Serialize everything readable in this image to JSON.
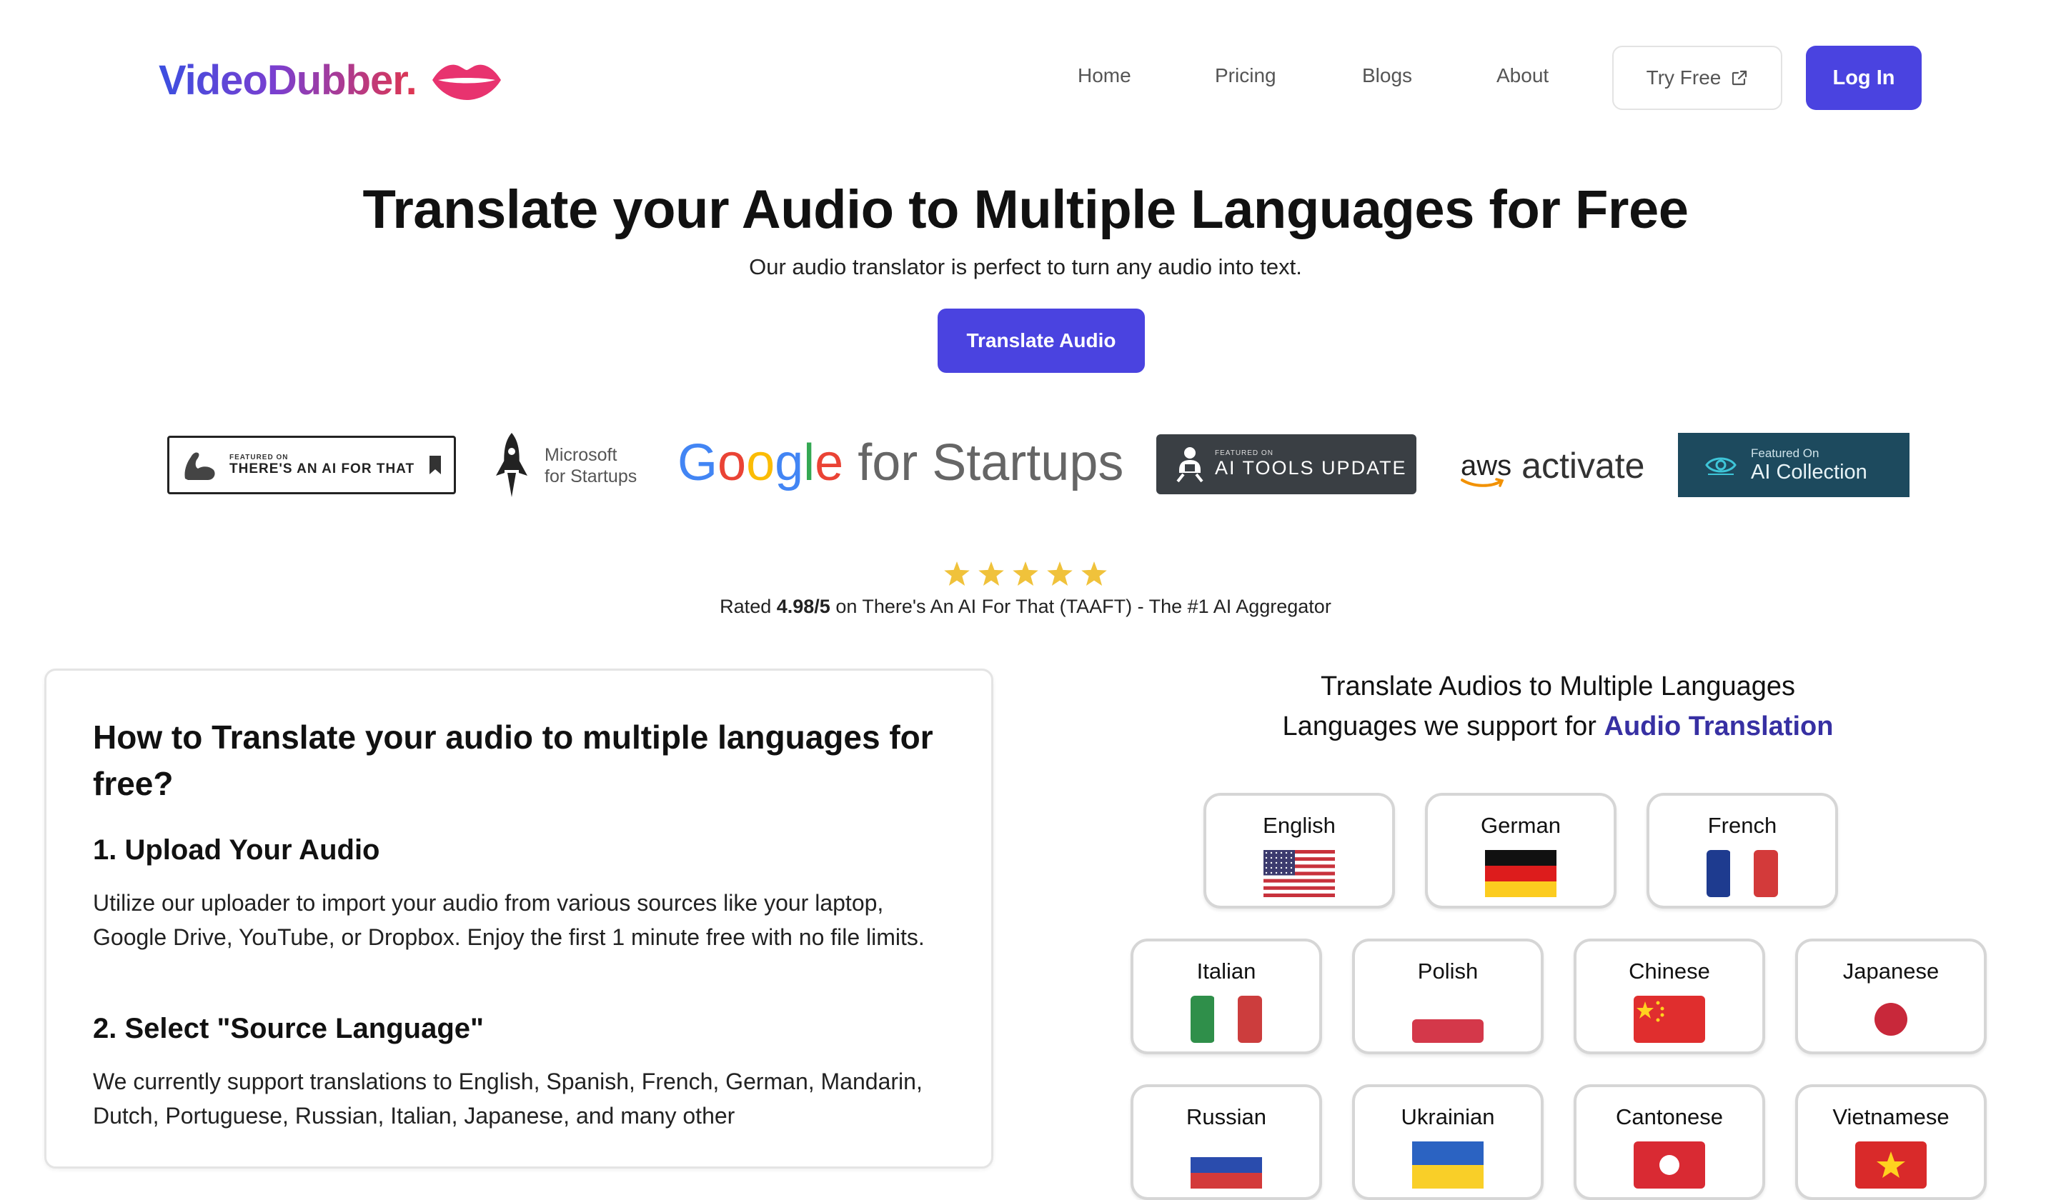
{
  "header": {
    "logo_text": "VideoDubber.",
    "nav": [
      "Home",
      "Pricing",
      "Blogs",
      "About"
    ],
    "try_free": "Try Free",
    "login": "Log In"
  },
  "hero": {
    "title": "Translate your Audio to Multiple Languages for Free",
    "subtitle": "Our audio translator is perfect to turn any audio into text.",
    "cta": "Translate Audio"
  },
  "featured": {
    "taaft_small": "FEATURED ON",
    "taaft_big": "THERE'S AN AI FOR THAT",
    "ms_line1": "Microsoft",
    "ms_line2": "for Startups",
    "google": "Google",
    "google_startups": "for Startups",
    "aitools_small": "FEATURED ON",
    "aitools_big": "AI TOOLS UPDATE",
    "aws": "aws",
    "aws_activate": "activate",
    "aicoll_small": "Featured On",
    "aicoll_big": "AI Collection"
  },
  "rating": {
    "stars": 5,
    "prefix": "Rated ",
    "score": "4.98/5",
    "suffix": " on There's An AI For That (TAAFT) - The #1 AI Aggregator"
  },
  "howto": {
    "title": "How to Translate your audio to multiple languages for free?",
    "steps": [
      {
        "title": "1. Upload Your Audio",
        "body": "Utilize our uploader to import your audio from various sources like your laptop, Google Drive, YouTube, or Dropbox. Enjoy the first 1 minute free with no file limits."
      },
      {
        "title": "2. Select \"Source Language\"",
        "body": "We currently support translations to English, Spanish, French, German, Mandarin, Dutch, Portuguese, Russian, Italian, Japanese, and many other"
      }
    ]
  },
  "languages": {
    "heading1": "Translate Audios to Multiple Languages",
    "heading2_prefix": "Languages we support for ",
    "heading2_highlight": "Audio Translation",
    "items": [
      {
        "name": "English",
        "flag": "us-flag-icon"
      },
      {
        "name": "German",
        "flag": "de-flag-icon"
      },
      {
        "name": "French",
        "flag": "fr-flag-icon"
      },
      {
        "name": "Italian",
        "flag": "it-flag-icon"
      },
      {
        "name": "Polish",
        "flag": "pl-flag-icon"
      },
      {
        "name": "Chinese",
        "flag": "cn-flag-icon"
      },
      {
        "name": "Japanese",
        "flag": "jp-flag-icon"
      },
      {
        "name": "Russian",
        "flag": "ru-flag-icon"
      },
      {
        "name": "Ukrainian",
        "flag": "ua-flag-icon"
      },
      {
        "name": "Cantonese",
        "flag": "hk-flag-icon"
      },
      {
        "name": "Vietnamese",
        "flag": "vn-flag-icon"
      }
    ]
  },
  "colors": {
    "primary": "#4a43e0",
    "highlight": "#3730a3",
    "star": "#f0c23b"
  }
}
